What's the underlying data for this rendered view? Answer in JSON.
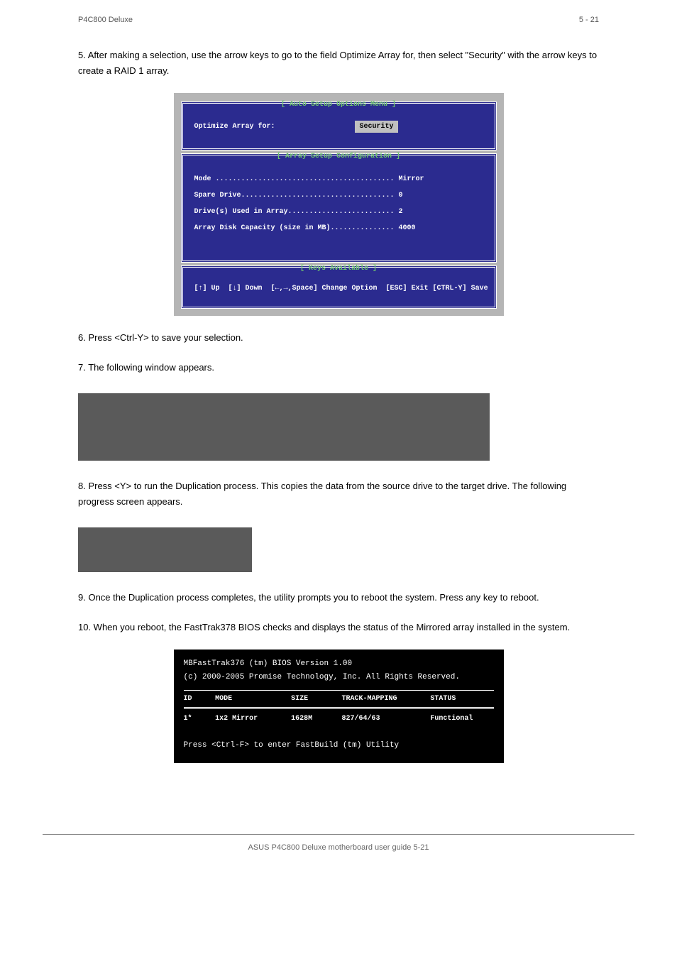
{
  "header": {
    "left": "P4C800 Deluxe",
    "right": "5 - 21"
  },
  "body_text": {
    "p1": "5. After making a selection, use the arrow keys to go to the field Optimize Array for, then select \"Security\" with the arrow keys to create a RAID 1 array.",
    "p2": "6. Press <Ctrl-Y> to save your selection.",
    "p3": "7. The following window appears.",
    "p4": "8. Press <Y> to run the Duplication process. This copies the data from the source drive to the target drive. The following progress screen appears.",
    "p5": "9. Once the Duplication process completes, the utility prompts you to reboot the system. Press any key to reboot.",
    "p6": "10. When you reboot, the FastTrak378 BIOS checks and displays the status of the Mirrored array installed in the system."
  },
  "bios1": {
    "title1": "[ Auto Setup Options Menu ]",
    "row1_label": "Optimize Array for:",
    "row1_value": "Security",
    "title2": "[ Array Setup Configuration ]",
    "line1": "Mode .......................................... Mirror",
    "line2": "Spare Drive.................................... 0",
    "line3": "Drive(s) Used in Array......................... 2",
    "line4": "Array Disk Capacity (size in MB)............... 4000",
    "title3": "[ Keys Available ]",
    "footer": "[↑] Up  [↓] Down  [←,→,Space] Change Option  [ESC] Exit [CTRL-Y] Save"
  },
  "bios2": {
    "line1": "MBFastTrak376 (tm) BIOS Version 1.00",
    "line2": "(c) 2000-2005 Promise Technology, Inc.  All Rights Reserved.",
    "h_id": "ID",
    "h_mode": "MODE",
    "h_size": "SIZE",
    "h_track": "TRACK-MAPPING",
    "h_status": "STATUS",
    "r_id": "1*",
    "r_mode": "1x2 Mirror",
    "r_size": "1628M",
    "r_track": "827/64/63",
    "r_status": "Functional",
    "line3": "Press <Ctrl-F> to enter FastBuild (tm) Utility"
  },
  "footer": {
    "text": "ASUS P4C800 Deluxe motherboard user guide 5-21"
  }
}
